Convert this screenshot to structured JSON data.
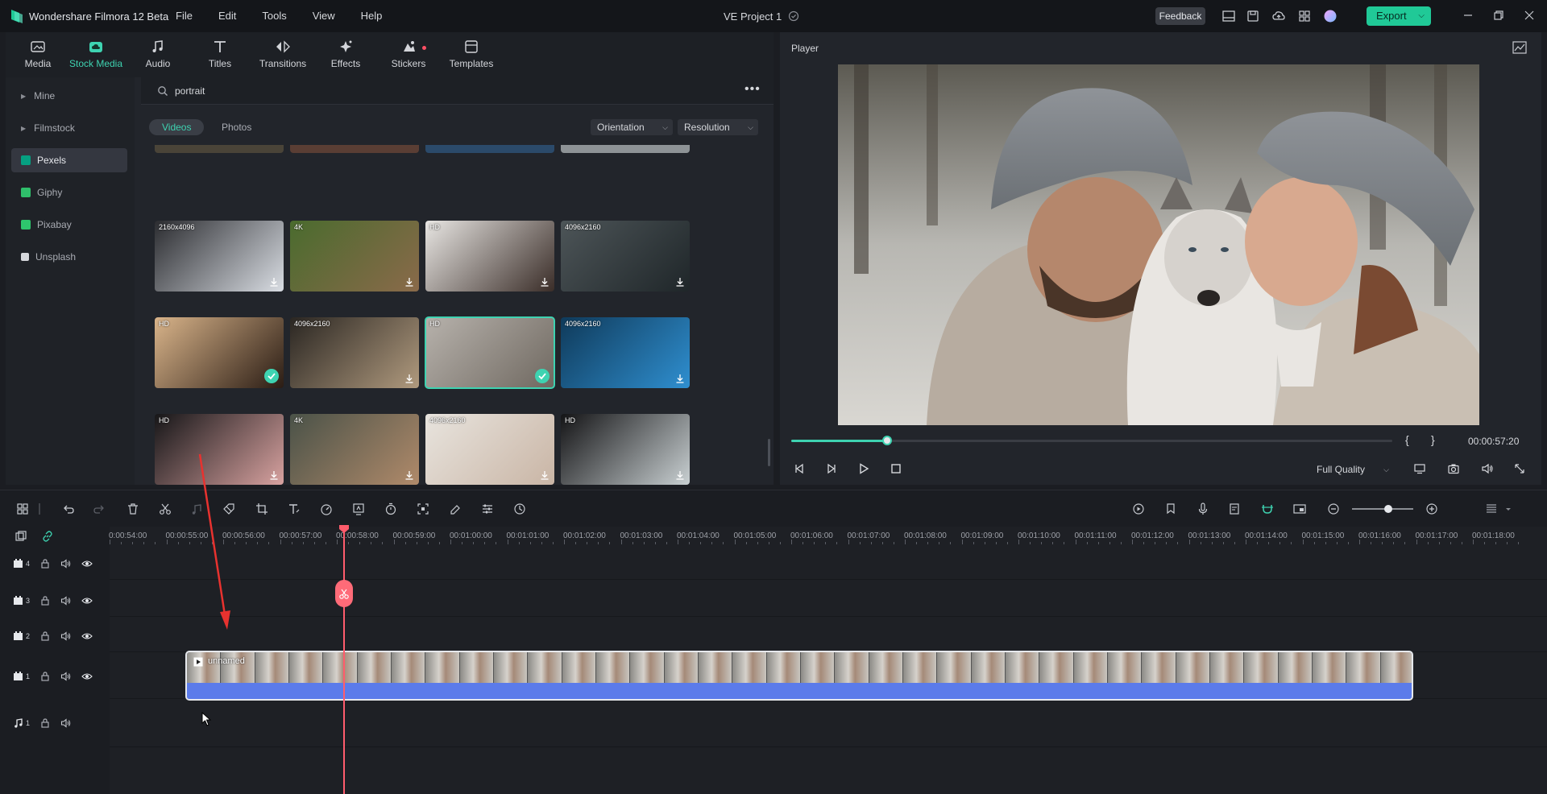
{
  "app": {
    "name": "Wondershare Filmora 12 Beta",
    "project_title": "VE Project 1",
    "menu": [
      "File",
      "Edit",
      "Tools",
      "View",
      "Help"
    ],
    "feedback_label": "Feedback",
    "export_label": "Export",
    "accent": "#20c997"
  },
  "media_tabs": [
    {
      "label": "Media",
      "icon": "media-icon"
    },
    {
      "label": "Stock Media",
      "icon": "cloud-icon",
      "active": true
    },
    {
      "label": "Audio",
      "icon": "music-note-icon"
    },
    {
      "label": "Titles",
      "icon": "text-icon"
    },
    {
      "label": "Transitions",
      "icon": "transition-icon"
    },
    {
      "label": "Effects",
      "icon": "sparkle-icon"
    },
    {
      "label": "Stickers",
      "icon": "sticker-icon"
    },
    {
      "label": "Templates",
      "icon": "template-icon"
    }
  ],
  "side_nav": [
    {
      "label": "Mine",
      "type": "expandable"
    },
    {
      "label": "Filmstock",
      "type": "expandable"
    },
    {
      "label": "Pexels",
      "type": "brand",
      "active": true,
      "color": "#05a081"
    },
    {
      "label": "Giphy",
      "type": "brand",
      "color": "#2fbf6b"
    },
    {
      "label": "Pixabay",
      "type": "brand",
      "color": "#2ec66d"
    },
    {
      "label": "Unsplash",
      "type": "brand",
      "color": "#d6d8dc"
    }
  ],
  "search": {
    "value": "portrait",
    "placeholder": "Search"
  },
  "filters": {
    "videos_label": "Videos",
    "photos_label": "Photos",
    "orientation_label": "Orientation",
    "resolution_label": "Resolution"
  },
  "thumbnails": [
    {
      "res": "2160x4096",
      "status": "download",
      "palette": [
        "#2b2c30",
        "#d9dde3"
      ]
    },
    {
      "res": "4K",
      "status": "download",
      "palette": [
        "#4a6b2e",
        "#8a6a4a"
      ]
    },
    {
      "res": "HD",
      "status": "download",
      "palette": [
        "#e8e6e3",
        "#3a2d28"
      ]
    },
    {
      "res": "4096x2160",
      "status": "download",
      "palette": [
        "#4d5558",
        "#1f2629"
      ]
    },
    {
      "res": "HD",
      "status": "added",
      "palette": [
        "#d9b48a",
        "#2a1c14"
      ]
    },
    {
      "res": "4096x2160",
      "status": "download",
      "palette": [
        "#2a2622",
        "#b09a7e"
      ]
    },
    {
      "res": "HD",
      "status": "added",
      "palette": [
        "#b7b2ac",
        "#6f6860"
      ],
      "selected": true
    },
    {
      "res": "4096x2160",
      "status": "download",
      "palette": [
        "#0f3a5a",
        "#2f8fd0"
      ]
    },
    {
      "res": "HD",
      "status": "download",
      "palette": [
        "#161618",
        "#d8a2a0"
      ]
    },
    {
      "res": "4K",
      "status": "download",
      "palette": [
        "#4a5248",
        "#b08a6a"
      ]
    },
    {
      "res": "4096x2160",
      "status": "download",
      "palette": [
        "#e8e4de",
        "#c9b5a5"
      ]
    },
    {
      "res": "HD",
      "status": "download",
      "palette": [
        "#141416",
        "#c9d0d2"
      ]
    }
  ],
  "player": {
    "title": "Player",
    "timecode": "00:00:57:20",
    "progress": 0.16,
    "quality": "Full Quality",
    "brace_open": "{",
    "brace_close": "}"
  },
  "timeline": {
    "ticks": [
      "0:00:54:00",
      "00:00:55:00",
      "00:00:56:00",
      "00:00:57:00",
      "00:00:58:00",
      "00:00:59:00",
      "00:01:00:00",
      "00:01:01:00",
      "00:01:02:00",
      "00:01:03:00",
      "00:01:04:00",
      "00:01:05:00",
      "00:01:06:00",
      "00:01:07:00",
      "00:01:08:00",
      "00:01:09:00",
      "00:01:10:00",
      "00:01:11:00",
      "00:01:12:00",
      "00:01:13:00",
      "00:01:14:00",
      "00:01:15:00",
      "00:01:16:00",
      "00:01:17:00",
      "00:01:18:00"
    ],
    "tracks": [
      {
        "num": "4",
        "kind": "video"
      },
      {
        "num": "3",
        "kind": "video"
      },
      {
        "num": "2",
        "kind": "video"
      },
      {
        "num": "1",
        "kind": "video"
      },
      {
        "num": "1",
        "kind": "audio"
      }
    ],
    "clip_name": "unnamed",
    "playhead_color": "#ff5c6c"
  }
}
